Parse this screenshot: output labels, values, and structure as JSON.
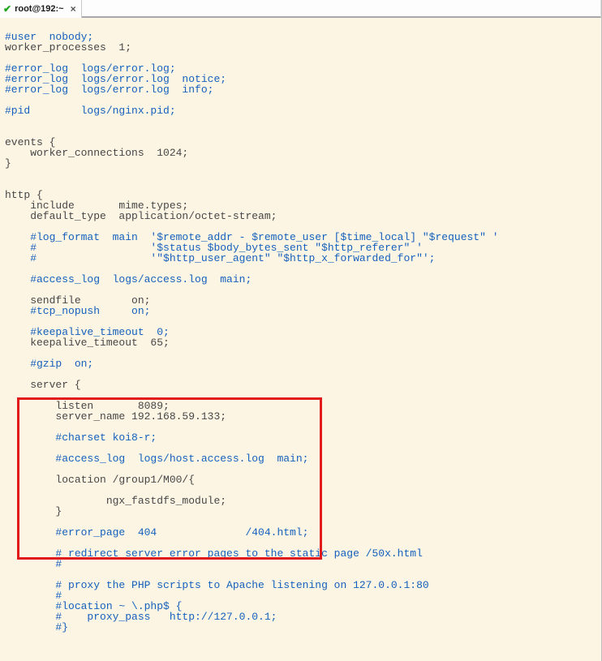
{
  "tab": {
    "title": "root@192:~",
    "checkmark": "✔",
    "close": "×"
  },
  "lines": [
    {
      "text": "",
      "cls": "plain"
    },
    {
      "text": "#user  nobody;",
      "cls": "comment"
    },
    {
      "text": "worker_processes  1;",
      "cls": "plain"
    },
    {
      "text": "",
      "cls": "plain"
    },
    {
      "text": "#error_log  logs/error.log;",
      "cls": "comment"
    },
    {
      "text": "#error_log  logs/error.log  notice;",
      "cls": "comment"
    },
    {
      "text": "#error_log  logs/error.log  info;",
      "cls": "comment"
    },
    {
      "text": "",
      "cls": "plain"
    },
    {
      "text": "#pid        logs/nginx.pid;",
      "cls": "comment"
    },
    {
      "text": "",
      "cls": "plain"
    },
    {
      "text": "",
      "cls": "plain"
    },
    {
      "text": "events {",
      "cls": "plain"
    },
    {
      "text": "    worker_connections  1024;",
      "cls": "plain"
    },
    {
      "text": "}",
      "cls": "plain"
    },
    {
      "text": "",
      "cls": "plain"
    },
    {
      "text": "",
      "cls": "plain"
    },
    {
      "text": "http {",
      "cls": "plain"
    },
    {
      "text": "    include       mime.types;",
      "cls": "plain"
    },
    {
      "text": "    default_type  application/octet-stream;",
      "cls": "plain"
    },
    {
      "text": "",
      "cls": "plain"
    },
    {
      "text": "    #log_format  main  '$remote_addr - $remote_user [$time_local] \"$request\" '",
      "cls": "comment"
    },
    {
      "text": "    #                  '$status $body_bytes_sent \"$http_referer\" '",
      "cls": "comment"
    },
    {
      "text": "    #                  '\"$http_user_agent\" \"$http_x_forwarded_for\"';",
      "cls": "comment"
    },
    {
      "text": "",
      "cls": "plain"
    },
    {
      "text": "    #access_log  logs/access.log  main;",
      "cls": "comment"
    },
    {
      "text": "",
      "cls": "plain"
    },
    {
      "text": "    sendfile        on;",
      "cls": "plain"
    },
    {
      "text": "    #tcp_nopush     on;",
      "cls": "comment"
    },
    {
      "text": "",
      "cls": "plain"
    },
    {
      "text": "    #keepalive_timeout  0;",
      "cls": "comment"
    },
    {
      "text": "    keepalive_timeout  65;",
      "cls": "plain"
    },
    {
      "text": "",
      "cls": "plain"
    },
    {
      "text": "    #gzip  on;",
      "cls": "comment"
    },
    {
      "text": "",
      "cls": "plain"
    },
    {
      "text": "    server {",
      "cls": "plain"
    },
    {
      "text": "",
      "cls": "plain"
    },
    {
      "text": "        listen       8089;",
      "cls": "plain"
    },
    {
      "text": "        server_name 192.168.59.133;",
      "cls": "plain"
    },
    {
      "text": "",
      "cls": "plain"
    },
    {
      "text": "        #charset koi8-r;",
      "cls": "comment"
    },
    {
      "text": "",
      "cls": "plain"
    },
    {
      "text": "        #access_log  logs/host.access.log  main;",
      "cls": "comment"
    },
    {
      "text": "",
      "cls": "plain"
    },
    {
      "text": "        location /group1/M00/{",
      "cls": "plain"
    },
    {
      "text": "",
      "cls": "plain"
    },
    {
      "text": "                ngx_fastdfs_module;",
      "cls": "plain"
    },
    {
      "text": "        }",
      "cls": "plain"
    },
    {
      "text": "",
      "cls": "plain"
    },
    {
      "text": "        #error_page  404              /404.html;",
      "cls": "comment"
    },
    {
      "text": "",
      "cls": "plain"
    },
    {
      "text": "        # redirect server error pages to the static page /50x.html",
      "cls": "comment"
    },
    {
      "text": "        #",
      "cls": "comment"
    },
    {
      "text": "",
      "cls": "plain"
    },
    {
      "text": "        # proxy the PHP scripts to Apache listening on 127.0.0.1:80",
      "cls": "comment"
    },
    {
      "text": "        #",
      "cls": "comment"
    },
    {
      "text": "        #location ~ \\.php$ {",
      "cls": "comment"
    },
    {
      "text": "        #    proxy_pass   http://127.0.0.1;",
      "cls": "comment"
    },
    {
      "text": "        #}",
      "cls": "comment"
    },
    {
      "text": "",
      "cls": "plain"
    }
  ]
}
